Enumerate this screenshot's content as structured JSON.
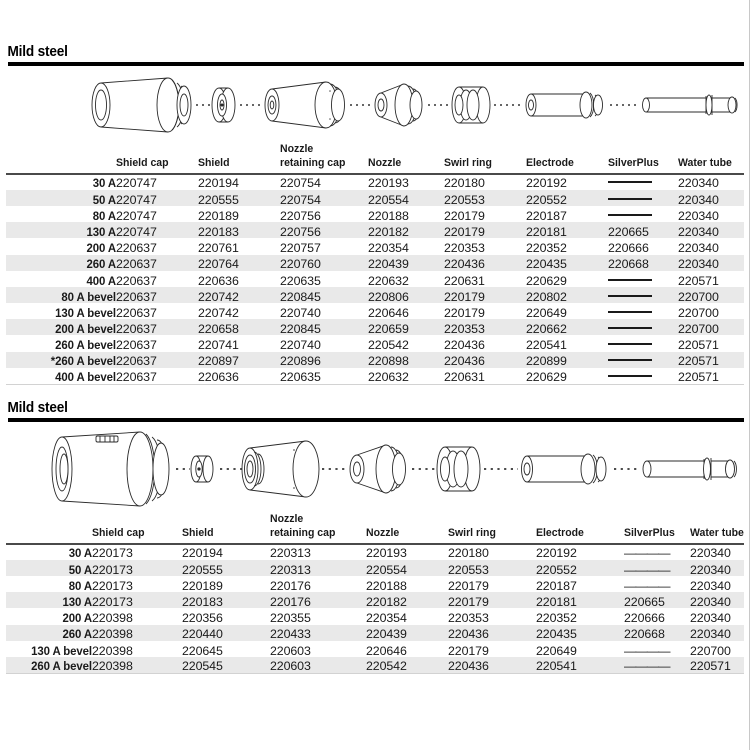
{
  "page": {
    "background_color": "#ffffff",
    "rule_color": "#000000",
    "stripe_color": "#e9e9e9"
  },
  "sections": [
    {
      "title": "Mild steel",
      "diagram": {
        "name": "exploded-consumables-diagram-1",
        "parts": [
          "Shield cap",
          "Shield",
          "Nozzle retaining cap",
          "Nozzle",
          "Swirl ring",
          "Electrode",
          "Water tube"
        ]
      },
      "columns": [
        {
          "key": "amperage",
          "label": ""
        },
        {
          "key": "shield_cap",
          "label": "Shield cap"
        },
        {
          "key": "shield",
          "label": "Shield"
        },
        {
          "key": "nozzle_retaining_cap",
          "label": "Nozzle\nretaining cap",
          "line1": "Nozzle",
          "line2": "retaining cap"
        },
        {
          "key": "nozzle",
          "label": "Nozzle"
        },
        {
          "key": "swirl_ring",
          "label": "Swirl ring"
        },
        {
          "key": "electrode",
          "label": "Electrode"
        },
        {
          "key": "silverplus",
          "label": "SilverPlus"
        },
        {
          "key": "water_tube",
          "label": "Water tube"
        }
      ],
      "rows": [
        {
          "amperage": "30 A",
          "shield_cap": "220747",
          "shield": "220194",
          "nozzle_retaining_cap": "220754",
          "nozzle": "220193",
          "swirl_ring": "220180",
          "electrode": "220192",
          "silverplus": "",
          "water_tube": "220340"
        },
        {
          "amperage": "50 A",
          "shield_cap": "220747",
          "shield": "220555",
          "nozzle_retaining_cap": "220754",
          "nozzle": "220554",
          "swirl_ring": "220553",
          "electrode": "220552",
          "silverplus": "",
          "water_tube": "220340"
        },
        {
          "amperage": "80 A",
          "shield_cap": "220747",
          "shield": "220189",
          "nozzle_retaining_cap": "220756",
          "nozzle": "220188",
          "swirl_ring": "220179",
          "electrode": "220187",
          "silverplus": "",
          "water_tube": "220340"
        },
        {
          "amperage": "130 A",
          "shield_cap": "220747",
          "shield": "220183",
          "nozzle_retaining_cap": "220756",
          "nozzle": "220182",
          "swirl_ring": "220179",
          "electrode": "220181",
          "silverplus": "220665",
          "water_tube": "220340"
        },
        {
          "amperage": "200 A",
          "shield_cap": "220637",
          "shield": "220761",
          "nozzle_retaining_cap": "220757",
          "nozzle": "220354",
          "swirl_ring": "220353",
          "electrode": "220352",
          "silverplus": "220666",
          "water_tube": "220340"
        },
        {
          "amperage": "260 A",
          "shield_cap": "220637",
          "shield": "220764",
          "nozzle_retaining_cap": "220760",
          "nozzle": "220439",
          "swirl_ring": "220436",
          "electrode": "220435",
          "silverplus": "220668",
          "water_tube": "220340"
        },
        {
          "amperage": "400 A",
          "shield_cap": "220637",
          "shield": "220636",
          "nozzle_retaining_cap": "220635",
          "nozzle": "220632",
          "swirl_ring": "220631",
          "electrode": "220629",
          "silverplus": "",
          "water_tube": "220571"
        },
        {
          "amperage": "80 A bevel",
          "shield_cap": "220637",
          "shield": "220742",
          "nozzle_retaining_cap": "220845",
          "nozzle": "220806",
          "swirl_ring": "220179",
          "electrode": "220802",
          "silverplus": "",
          "water_tube": "220700"
        },
        {
          "amperage": "130 A bevel",
          "shield_cap": "220637",
          "shield": "220742",
          "nozzle_retaining_cap": "220740",
          "nozzle": "220646",
          "swirl_ring": "220179",
          "electrode": "220649",
          "silverplus": "",
          "water_tube": "220700"
        },
        {
          "amperage": "200 A bevel",
          "shield_cap": "220637",
          "shield": "220658",
          "nozzle_retaining_cap": "220845",
          "nozzle": "220659",
          "swirl_ring": "220353",
          "electrode": "220662",
          "silverplus": "",
          "water_tube": "220700"
        },
        {
          "amperage": "260 A bevel",
          "shield_cap": "220637",
          "shield": "220741",
          "nozzle_retaining_cap": "220740",
          "nozzle": "220542",
          "swirl_ring": "220436",
          "electrode": "220541",
          "silverplus": "",
          "water_tube": "220571"
        },
        {
          "amperage": "*260 A bevel",
          "shield_cap": "220637",
          "shield": "220897",
          "nozzle_retaining_cap": "220896",
          "nozzle": "220898",
          "swirl_ring": "220436",
          "electrode": "220899",
          "silverplus": "",
          "water_tube": "220571"
        },
        {
          "amperage": "400 A bevel",
          "shield_cap": "220637",
          "shield": "220636",
          "nozzle_retaining_cap": "220635",
          "nozzle": "220632",
          "swirl_ring": "220631",
          "electrode": "220629",
          "silverplus": "",
          "water_tube": "220571"
        }
      ],
      "empty_marker": "solid-dash"
    },
    {
      "title": "Mild steel",
      "diagram": {
        "name": "exploded-consumables-diagram-2",
        "parts": [
          "Shield cap",
          "Shield",
          "Nozzle retaining cap",
          "Nozzle",
          "Swirl ring",
          "Electrode",
          "Water tube"
        ]
      },
      "columns": [
        {
          "key": "amperage",
          "label": ""
        },
        {
          "key": "shield_cap",
          "label": "Shield cap"
        },
        {
          "key": "shield",
          "label": "Shield"
        },
        {
          "key": "nozzle_retaining_cap",
          "label": "Nozzle\nretaining cap",
          "line1": "Nozzle",
          "line2": "retaining cap"
        },
        {
          "key": "nozzle",
          "label": "Nozzle"
        },
        {
          "key": "swirl_ring",
          "label": "Swirl ring"
        },
        {
          "key": "electrode",
          "label": "Electrode"
        },
        {
          "key": "silverplus",
          "label": "SilverPlus"
        },
        {
          "key": "water_tube",
          "label": "Water tube"
        }
      ],
      "rows": [
        {
          "amperage": "30 A",
          "shield_cap": "220173",
          "shield": "220194",
          "nozzle_retaining_cap": "220313",
          "nozzle": "220193",
          "swirl_ring": "220180",
          "electrode": "220192",
          "silverplus": "",
          "water_tube": "220340"
        },
        {
          "amperage": "50 A",
          "shield_cap": "220173",
          "shield": "220555",
          "nozzle_retaining_cap": "220313",
          "nozzle": "220554",
          "swirl_ring": "220553",
          "electrode": "220552",
          "silverplus": "",
          "water_tube": "220340"
        },
        {
          "amperage": "80 A",
          "shield_cap": "220173",
          "shield": "220189",
          "nozzle_retaining_cap": "220176",
          "nozzle": "220188",
          "swirl_ring": "220179",
          "electrode": "220187",
          "silverplus": "",
          "water_tube": "220340"
        },
        {
          "amperage": "130 A",
          "shield_cap": "220173",
          "shield": "220183",
          "nozzle_retaining_cap": "220176",
          "nozzle": "220182",
          "swirl_ring": "220179",
          "electrode": "220181",
          "silverplus": "220665",
          "water_tube": "220340"
        },
        {
          "amperage": "200 A",
          "shield_cap": "220398",
          "shield": "220356",
          "nozzle_retaining_cap": "220355",
          "nozzle": "220354",
          "swirl_ring": "220353",
          "electrode": "220352",
          "silverplus": "220666",
          "water_tube": "220340"
        },
        {
          "amperage": "260 A",
          "shield_cap": "220398",
          "shield": "220440",
          "nozzle_retaining_cap": "220433",
          "nozzle": "220439",
          "swirl_ring": "220436",
          "electrode": "220435",
          "silverplus": "220668",
          "water_tube": "220340"
        },
        {
          "amperage": "130 A bevel",
          "shield_cap": "220398",
          "shield": "220645",
          "nozzle_retaining_cap": "220603",
          "nozzle": "220646",
          "swirl_ring": "220179",
          "electrode": "220649",
          "silverplus": "",
          "water_tube": "220700"
        },
        {
          "amperage": "260 A bevel",
          "shield_cap": "220398",
          "shield": "220545",
          "nozzle_retaining_cap": "220603",
          "nozzle": "220542",
          "swirl_ring": "220436",
          "electrode": "220541",
          "silverplus": "",
          "water_tube": "220571"
        }
      ],
      "empty_marker": "segmented-dash",
      "empty_marker_text": "————"
    }
  ]
}
